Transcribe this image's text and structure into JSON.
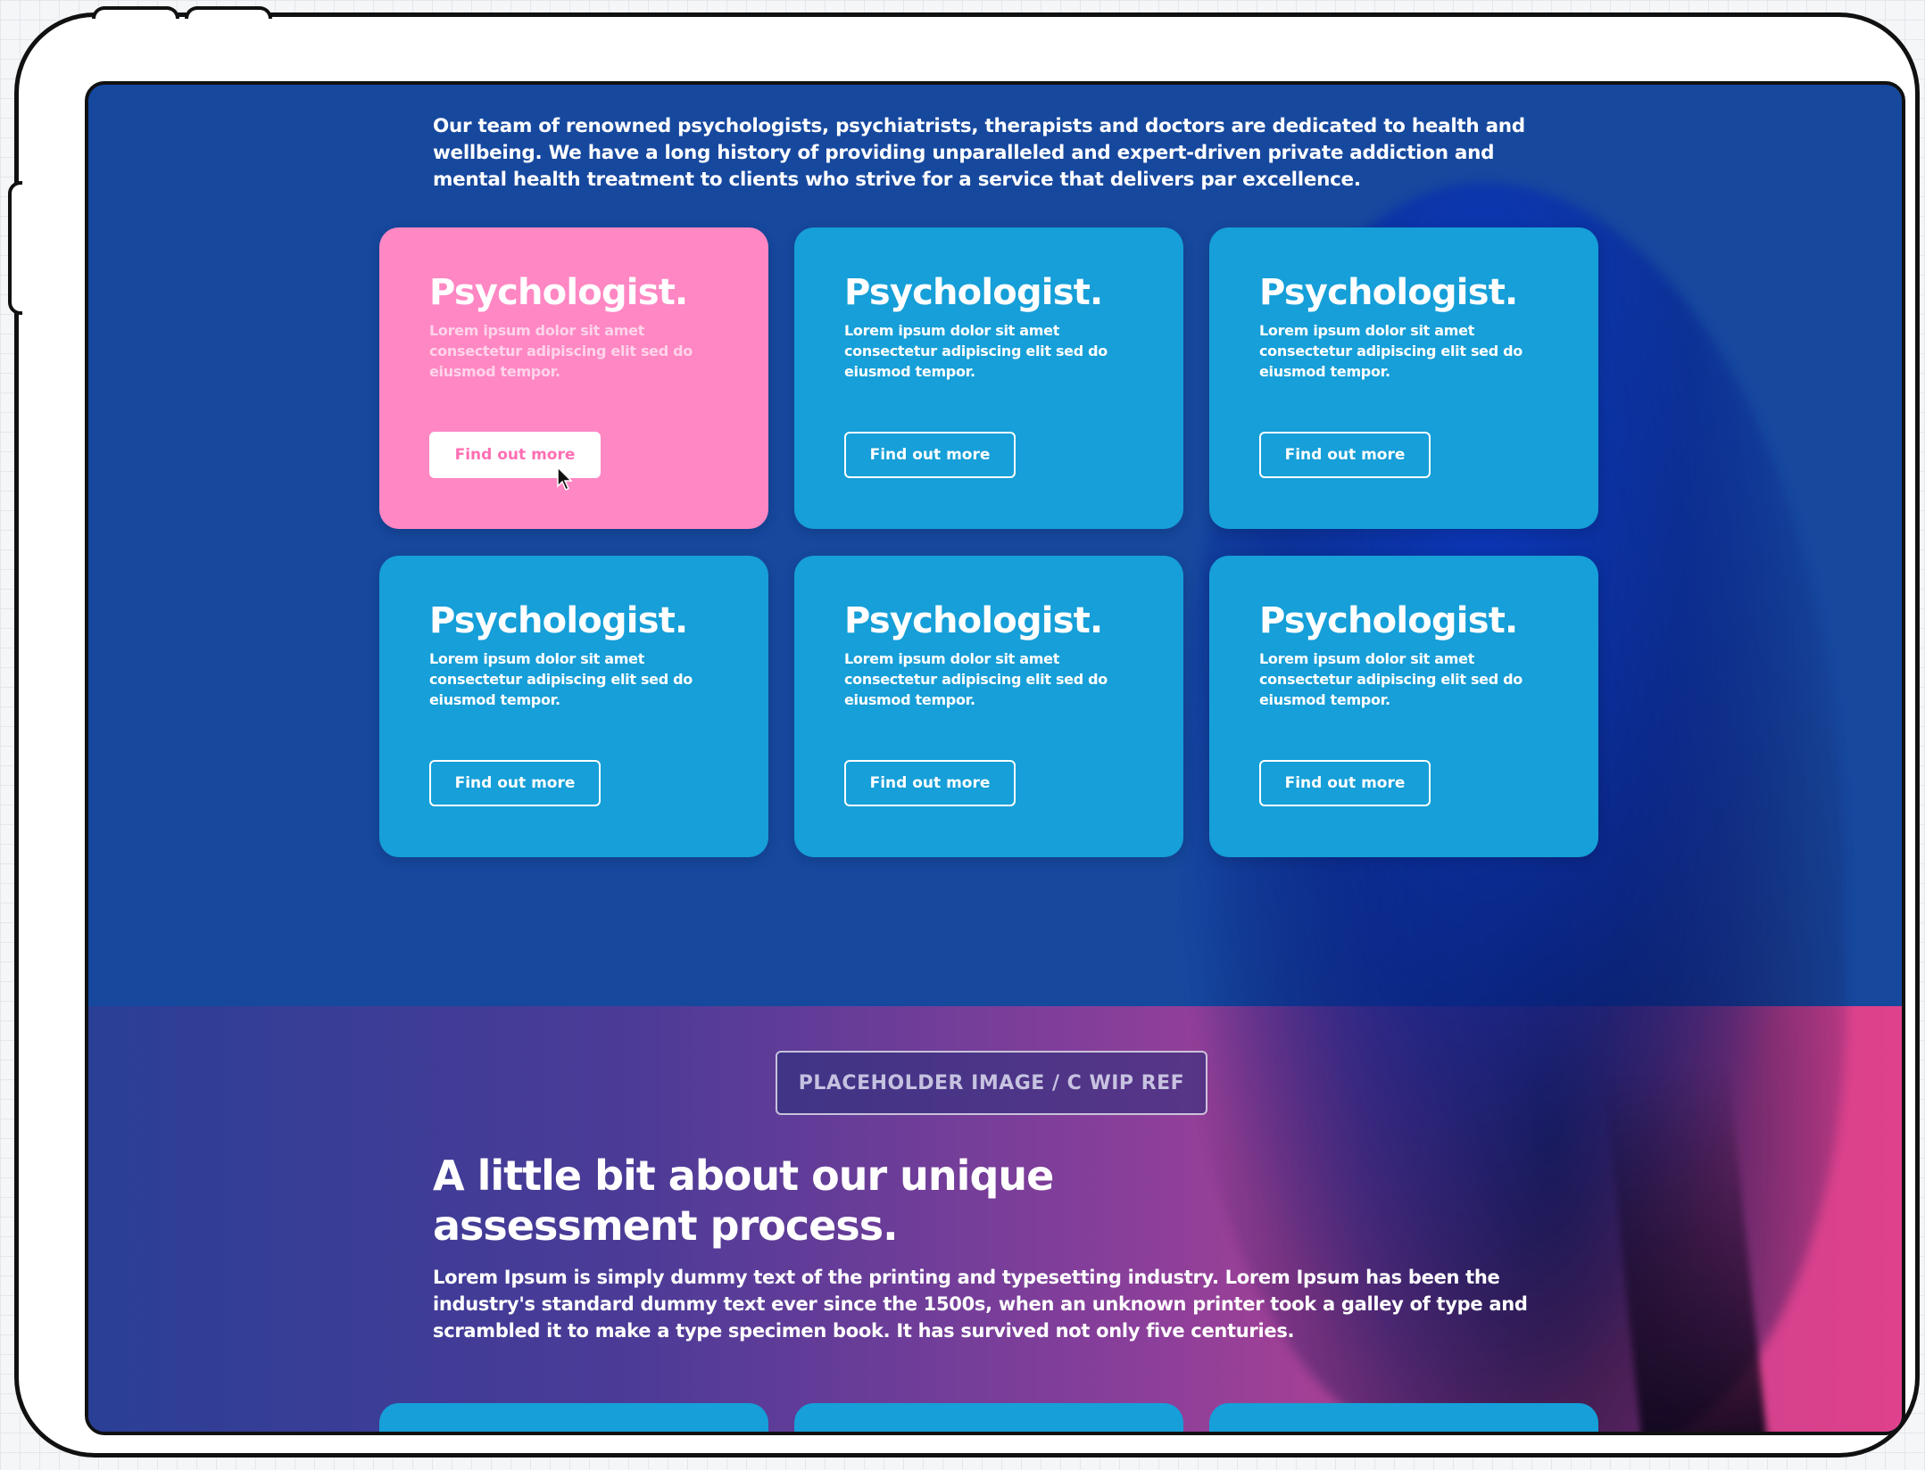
{
  "intro": {
    "text": "Our team of renowned psychologists, psychiatrists, therapists and doctors are dedicated to health and wellbeing. We have a long history of providing unparalleled and expert-driven private addiction and mental health treatment to clients who strive for a service that delivers par excellence."
  },
  "cards": [
    {
      "title": "Psychologist.",
      "description": "Lorem ipsum dolor sit amet consectetur adipiscing elit sed do eiusmod tempor.",
      "button": "Find out more",
      "state": "hover"
    },
    {
      "title": "Psychologist.",
      "description": "Lorem ipsum dolor sit amet consectetur adipiscing elit sed do eiusmod tempor.",
      "button": "Find out more"
    },
    {
      "title": "Psychologist.",
      "description": "Lorem ipsum dolor sit amet consectetur adipiscing elit sed do eiusmod tempor.",
      "button": "Find out more"
    },
    {
      "title": "Psychologist.",
      "description": "Lorem ipsum dolor sit amet consectetur adipiscing elit sed do eiusmod tempor.",
      "button": "Find out more"
    },
    {
      "title": "Psychologist.",
      "description": "Lorem ipsum dolor sit amet consectetur adipiscing elit sed do eiusmod tempor.",
      "button": "Find out more"
    },
    {
      "title": "Psychologist.",
      "description": "Lorem ipsum dolor sit amet consectetur adipiscing elit sed do eiusmod tempor.",
      "button": "Find out more"
    }
  ],
  "placeholder": {
    "label": "PLACEHOLDER IMAGE / C WIP REF"
  },
  "assessment": {
    "title": "A little bit about our unique assessment process.",
    "body": "Lorem Ipsum is simply dummy text of the printing and typesetting industry. Lorem Ipsum has been the industry's standard dummy text ever since the 1500s, when an unknown printer took a galley of type and scrambled it to make a type specimen book. It has survived not only five centuries."
  },
  "colors": {
    "background_blue": "#16489e",
    "card_blue": "#169fd8",
    "card_pink": "#ff87c3",
    "gradient_pink": "#e0418c"
  },
  "icons": {
    "cursor": "mouse-pointer-icon"
  }
}
